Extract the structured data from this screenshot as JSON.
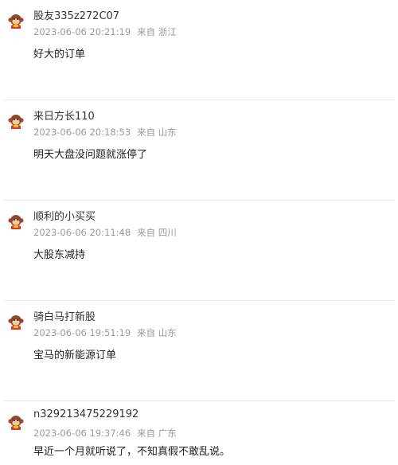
{
  "comments": [
    {
      "username": "股友335z272C07",
      "time": "2023-06-06 20:21:19",
      "source": "来自 浙江",
      "content": "好大的订单"
    },
    {
      "username": "来日方长110",
      "time": "2023-06-06 20:18:53",
      "source": "来自 山东",
      "content": "明天大盘没问题就涨停了"
    },
    {
      "username": "顺利的小买买",
      "time": "2023-06-06 20:11:48",
      "source": "来自 四川",
      "content": "大股东减持"
    },
    {
      "username": "骑白马打新股",
      "time": "2023-06-06 19:51:19",
      "source": "来自 山东",
      "content": "宝马的新能源订单"
    },
    {
      "username": "n329213475229192",
      "time": "2023-06-06 19:37:46",
      "source": "来自 广东",
      "content": "早近一个月就听说了，不知真假不敢乱说。"
    }
  ],
  "icons": {
    "avatar": "monkey-avatar-icon"
  }
}
